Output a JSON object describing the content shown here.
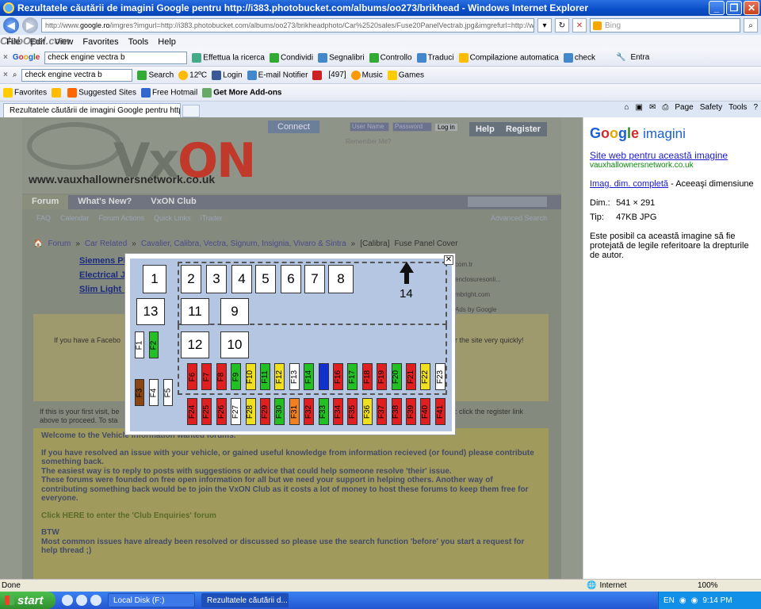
{
  "window": {
    "title": "Rezultatele căutării de imagini Google pentru http://i383.photobucket.com/albums/oo273/brikhead - Windows Internet Explorer",
    "url_prefix": "http://www.",
    "url_domain": "google.ro",
    "url_rest": "/imgres?imgurl=http://i383.photobucket.com/albums/oo273/brikheadphoto/Car%2520sales/Fuse20PanelVectrab.jpg&imgrefurl=http://www.va",
    "search_provider": "Bing"
  },
  "menu": {
    "watermark": "ClubOpel.com",
    "items": [
      "File",
      "Edit",
      "View",
      "Favorites",
      "Tools",
      "Help"
    ]
  },
  "google_toolbar": {
    "query": "check engine vectra b",
    "search_label": "Effettua la ricerca",
    "share_label": "Condividi",
    "bookmarks_label": "Segnalibri",
    "check_label": "Controllo",
    "translate_label": "Traduci",
    "autofill_label": "Compilazione automatica",
    "check2_label": "check",
    "signin_label": "Entra"
  },
  "second_toolbar": {
    "query": "check engine vectra b",
    "search_label": "Search",
    "weather": "12ºC",
    "login_label": "Login",
    "email_label": "E-mail Notifier",
    "count_label": "[497]",
    "music_label": "Music",
    "games_label": "Games"
  },
  "favorites_bar": {
    "favorites_label": "Favorites",
    "items": [
      "Suggested Sites",
      "Free Hotmail",
      "Get More Add-ons"
    ]
  },
  "tab": {
    "title": "Rezultatele căutării de imagini Google pentru http://i3..."
  },
  "tab_tools": {
    "page": "Page",
    "safety": "Safety",
    "tools": "Tools"
  },
  "site": {
    "url_text": "www.vauxhallownersnetwork.co.uk",
    "logo_vx": "Vx",
    "logo_on": "ON",
    "connect": "Connect",
    "username_placeholder": "User Name",
    "password_placeholder": "Password",
    "login_button": "Log in",
    "remember": "Remember Me?",
    "help": "Help",
    "register": "Register",
    "nav": [
      "Forum",
      "What's New?",
      "VxON Club"
    ],
    "subnav": [
      "FAQ",
      "Calendar",
      "Forum Actions",
      "Quick Links",
      "iTrader"
    ],
    "advanced_search": "Advanced Search",
    "breadcrumb": [
      "Forum",
      "Car Related",
      "Cavalier, Calibra, Vectra, Signum, Insignia, Vivaro & Sintra",
      "[Calibra]",
      "Fuse Panel Cover"
    ],
    "ads": [
      "Siemens Pl",
      "Electrical J",
      "Slim Light I"
    ],
    "ads_right": [
      "com.tr",
      "enclosuresonli...",
      "mbright.com",
      "Ads by Google"
    ],
    "facebook_text": "If you have a Facebo",
    "facebook_text_right": "r the site very quickly!",
    "first_visit": "If this is your first visit, be",
    "first_visit2": "above to proceed. To sta",
    "first_visit_right": ": click the register link",
    "welcome": {
      "title": "Welcome to the Vehicle information wanted forums.",
      "p1": "If you have resolved an issue with your vehicle, or gained useful knowledge from information recieved (or found) please contribute something back.",
      "p2": "The easiest way is to reply to posts with suggestions or advice that could help someone resolve 'their' issue.",
      "p3": "These forums were founded on free open information for all but we need your support in helping others. Another way of contributing something back would be to join the VxON Club as it costs a lot of money to host these forums to keep them free for everyone.",
      "p4": "Click HERE to enter the 'Club Enquiries' forum",
      "p5": "BTW",
      "p6": "Most common issues have already been resolved or discussed so please use the search function 'before' you start a request for help thread ;)"
    }
  },
  "fuse_diagram": {
    "big_fuses": [
      "1",
      "2",
      "3",
      "4",
      "5",
      "6",
      "7",
      "8",
      "13",
      "11",
      "9",
      "12",
      "10"
    ],
    "arrow_label": "14",
    "left_small": [
      {
        "label": "F1",
        "color": "#ffffff"
      },
      {
        "label": "F2",
        "color": "#22c022"
      },
      {
        "label": "F3",
        "color": "#8b4513"
      },
      {
        "label": "F4",
        "color": "#ffffff"
      },
      {
        "label": "F5",
        "color": "#ffffff"
      }
    ],
    "row1": [
      {
        "label": "F6",
        "color": "#e02020"
      },
      {
        "label": "F7",
        "color": "#e02020"
      },
      {
        "label": "F8",
        "color": "#e02020"
      },
      {
        "label": "F9",
        "color": "#22c022"
      },
      {
        "label": "F10",
        "color": "#f0e020"
      },
      {
        "label": "F11",
        "color": "#22c022"
      },
      {
        "label": "F12",
        "color": "#f0e020"
      },
      {
        "label": "F13",
        "color": "#ffffff"
      },
      {
        "label": "F14",
        "color": "#22c022"
      },
      {
        "label": "F15",
        "color": "#1030d0"
      },
      {
        "label": "F16",
        "color": "#e02020"
      },
      {
        "label": "F17",
        "color": "#22c022"
      },
      {
        "label": "F18",
        "color": "#e02020"
      },
      {
        "label": "F19",
        "color": "#e02020"
      },
      {
        "label": "F20",
        "color": "#22c022"
      },
      {
        "label": "F21",
        "color": "#e02020"
      },
      {
        "label": "F22",
        "color": "#f0e020"
      },
      {
        "label": "F23",
        "color": "#ffffff"
      }
    ],
    "row2": [
      {
        "label": "F24",
        "color": "#e02020"
      },
      {
        "label": "F25",
        "color": "#e02020"
      },
      {
        "label": "F26",
        "color": "#e02020"
      },
      {
        "label": "F27",
        "color": "#ffffff"
      },
      {
        "label": "F28",
        "color": "#f0e020"
      },
      {
        "label": "F29",
        "color": "#e02020"
      },
      {
        "label": "F30",
        "color": "#22c022"
      },
      {
        "label": "F31",
        "color": "#f08020"
      },
      {
        "label": "F32",
        "color": "#e02020"
      },
      {
        "label": "F33",
        "color": "#22c022"
      },
      {
        "label": "F34",
        "color": "#e02020"
      },
      {
        "label": "F35",
        "color": "#e02020"
      },
      {
        "label": "F36",
        "color": "#f0e020"
      },
      {
        "label": "F37",
        "color": "#e02020"
      },
      {
        "label": "F38",
        "color": "#e02020"
      },
      {
        "label": "F39",
        "color": "#e02020"
      },
      {
        "label": "F40",
        "color": "#e02020"
      },
      {
        "label": "F41",
        "color": "#e02020"
      }
    ]
  },
  "right_pane": {
    "google": "Google",
    "imagini": "imagini",
    "site_link": "Site web pentru această imagine",
    "domain": "vauxhallownersnetwork.co.uk",
    "full_size_link": "Imag. dim. completă",
    "same_size": "- Aceeaşi dimensiune",
    "dim_label": "Dim.:",
    "dim_value": "541 × 291",
    "type_label": "Tip:",
    "type_value": "47KB JPG",
    "copyright": "Este posibil ca această imagine să fie protejată de legile referitoare la drepturile de autor."
  },
  "status_bar": {
    "status": "Done",
    "zone": "Internet",
    "zoom": "100%"
  },
  "taskbar": {
    "start": "start",
    "items": [
      "Local Disk (F:)",
      "Rezultatele căutării d..."
    ],
    "lang": "EN",
    "time": "9:14 PM"
  }
}
